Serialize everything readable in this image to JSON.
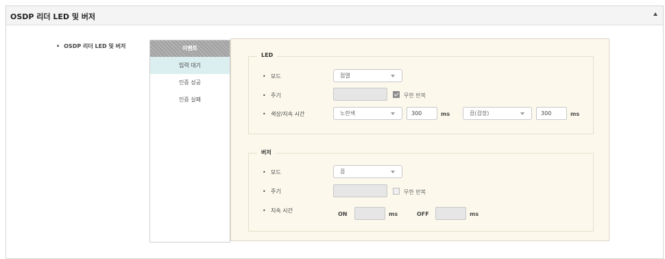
{
  "panel": {
    "title": "OSDP 리더 LED 및 버저",
    "collapse_icon": "triangle-up-icon"
  },
  "section_label": "OSDP 리더 LED 및 버저",
  "bullet": "•",
  "events": {
    "header": "이벤트",
    "items": [
      {
        "label": "입력 대기",
        "active": true
      },
      {
        "label": "인증 성공",
        "active": false
      },
      {
        "label": "인증 실패",
        "active": false
      }
    ]
  },
  "led": {
    "legend": "LED",
    "mode_label": "모드",
    "mode_value": "점멸",
    "period_label": "주기",
    "period_value": "",
    "repeat_label": "무한 반복",
    "repeat_checked": true,
    "color_label": "색상/지속 시간",
    "color1": "노란색",
    "duration1": "300",
    "color2": "끔(검정)",
    "duration2": "300",
    "unit": "ms"
  },
  "buzzer": {
    "legend": "버저",
    "mode_label": "모드",
    "mode_value": "끔",
    "period_label": "주기",
    "period_value": "",
    "repeat_label": "무한 반복",
    "repeat_checked": false,
    "duration_label": "지속 시간",
    "on_label": "ON",
    "on_value": "",
    "off_label": "OFF",
    "off_value": "",
    "unit": "ms"
  },
  "colors": {
    "header_bg": "#f4f4f4",
    "event_header": "#a9a9a9",
    "active_event": "#dbeef0",
    "config_bg": "#fcf9ec"
  }
}
